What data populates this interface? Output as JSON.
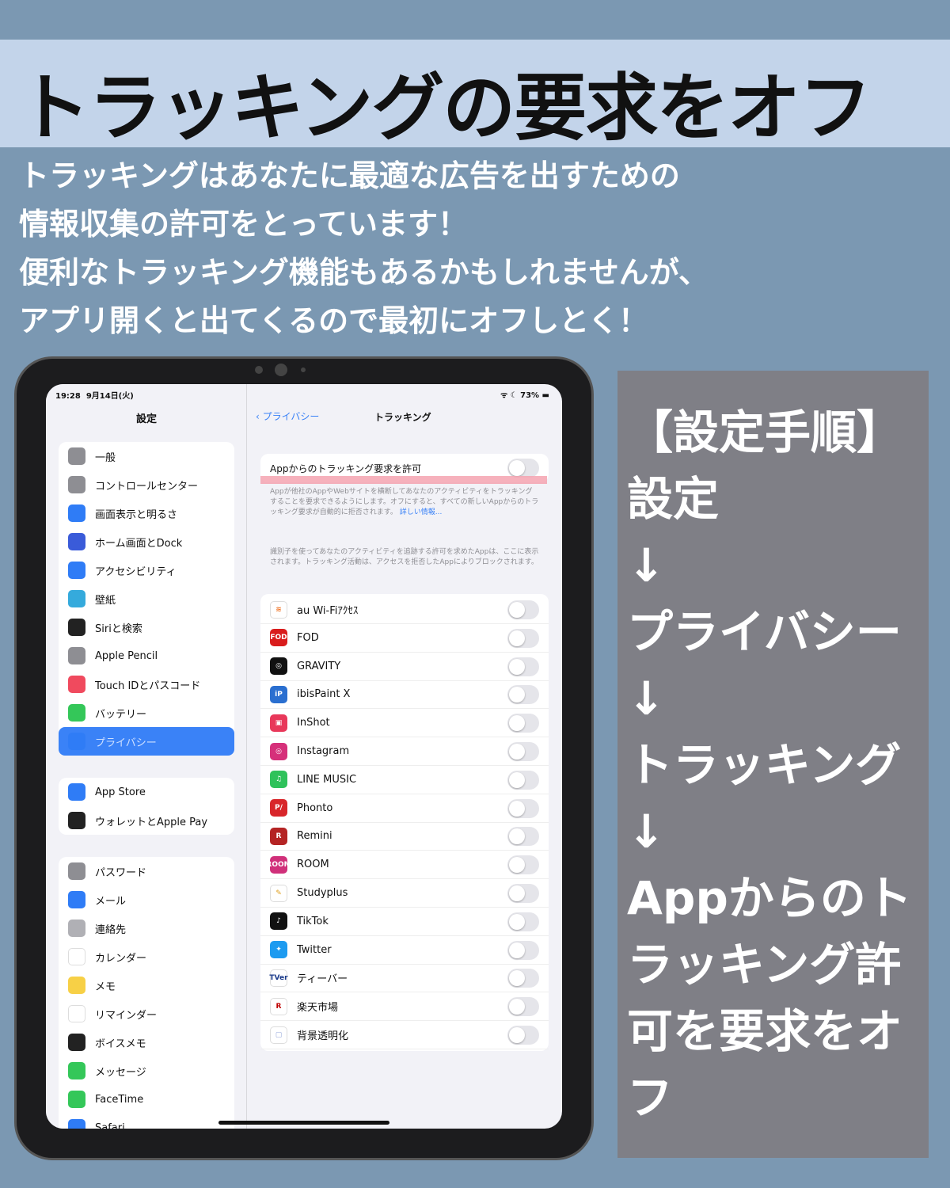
{
  "title": "トラッキングの要求をオフ",
  "intro": [
    "トラッキングはあなたに最適な広告を出すための",
    "情報収集の許可をとっています！",
    "便利なトラッキング機能もあるかもしれませんが、",
    "アプリ開くと出てくるので最初にオフしとく！"
  ],
  "status": {
    "time": "19:28",
    "date": "9月14日(火)",
    "battery": "73%"
  },
  "sidebar": {
    "title": "設定",
    "groups": [
      [
        {
          "label": "一般",
          "color": "#8e8e93",
          "icon": "gear-icon"
        },
        {
          "label": "コントロールセンター",
          "color": "#8e8e93",
          "icon": "toggles-icon"
        },
        {
          "label": "画面表示と明るさ",
          "color": "#2f7cf6",
          "icon": "text-size-icon"
        },
        {
          "label": "ホーム画面とDock",
          "color": "#3a5bd9",
          "icon": "grid-icon"
        },
        {
          "label": "アクセシビリティ",
          "color": "#2f7cf6",
          "icon": "accessibility-icon"
        },
        {
          "label": "壁紙",
          "color": "#35aadc",
          "icon": "flower-icon"
        },
        {
          "label": "Siriと検索",
          "color": "#222",
          "icon": "siri-icon"
        },
        {
          "label": "Apple Pencil",
          "color": "#8e8e93",
          "icon": "pencil-icon"
        },
        {
          "label": "Touch IDとパスコード",
          "color": "#f04a5e",
          "icon": "fingerprint-icon"
        },
        {
          "label": "バッテリー",
          "color": "#34c759",
          "icon": "battery-icon"
        },
        {
          "label": "プライバシー",
          "color": "#2f7cf6",
          "icon": "hand-icon",
          "selected": true
        }
      ],
      [
        {
          "label": "App Store",
          "color": "#2f7cf6",
          "icon": "app-store-icon"
        },
        {
          "label": "ウォレットとApple Pay",
          "color": "#222",
          "icon": "wallet-icon"
        }
      ],
      [
        {
          "label": "パスワード",
          "color": "#8e8e93",
          "icon": "key-icon"
        },
        {
          "label": "メール",
          "color": "#2f7cf6",
          "icon": "mail-icon"
        },
        {
          "label": "連絡先",
          "color": "#b0b0b5",
          "icon": "contacts-icon"
        },
        {
          "label": "カレンダー",
          "color": "#ffffff",
          "icon": "calendar-icon"
        },
        {
          "label": "メモ",
          "color": "#f7d046",
          "icon": "notes-icon"
        },
        {
          "label": "リマインダー",
          "color": "#ffffff",
          "icon": "reminders-icon"
        },
        {
          "label": "ボイスメモ",
          "color": "#222",
          "icon": "voice-memo-icon"
        },
        {
          "label": "メッセージ",
          "color": "#34c759",
          "icon": "message-icon"
        },
        {
          "label": "FaceTime",
          "color": "#34c759",
          "icon": "video-icon"
        },
        {
          "label": "Safari",
          "color": "#2f7cf6",
          "icon": "compass-icon"
        }
      ]
    ]
  },
  "main": {
    "back": "プライバシー",
    "title": "トラッキング",
    "allow_label": "Appからのトラッキング要求を許可",
    "allow_on": false,
    "desc": "Appが他社のAppやWebサイトを横断してあなたのアクティビティをトラッキングすることを要求できるようにします。オフにすると、すべての新しいAppからのトラッキング要求が自動的に拒否されます。",
    "more": "詳しい情報...",
    "note": "識別子を使ってあなたのアクティビティを追跡する許可を求めたAppは、ここに表示されます。トラッキング活動は、アクセスを拒否したAppによりブロックされます。",
    "apps": [
      {
        "name": "au Wi-Fiｱｸｾｽ",
        "color": "#ffffff",
        "fg": "#f07020",
        "icon": "wifi-icon",
        "glyph": "≋"
      },
      {
        "name": "FOD",
        "color": "#d91c1c",
        "icon": "fod-icon",
        "glyph": "FOD"
      },
      {
        "name": "GRAVITY",
        "color": "#111",
        "icon": "gravity-icon",
        "glyph": "◎"
      },
      {
        "name": "ibisPaint X",
        "color": "#2a6fd0",
        "icon": "ibispaint-icon",
        "glyph": "iP"
      },
      {
        "name": "InShot",
        "color": "#e8385a",
        "icon": "inshot-icon",
        "glyph": "▣"
      },
      {
        "name": "Instagram",
        "color": "#d6307a",
        "icon": "instagram-icon",
        "glyph": "◎"
      },
      {
        "name": "LINE MUSIC",
        "color": "#2fc25b",
        "icon": "line-music-icon",
        "glyph": "♫"
      },
      {
        "name": "Phonto",
        "color": "#d8262a",
        "icon": "phonto-icon",
        "glyph": "P/"
      },
      {
        "name": "Remini",
        "color": "#b42424",
        "icon": "remini-icon",
        "glyph": "R"
      },
      {
        "name": "ROOM",
        "color": "#d0307a",
        "icon": "room-icon",
        "glyph": "ROOM"
      },
      {
        "name": "Studyplus",
        "color": "#ffffff",
        "fg": "#e0a020",
        "icon": "studyplus-icon",
        "glyph": "✎"
      },
      {
        "name": "TikTok",
        "color": "#111",
        "icon": "tiktok-icon",
        "glyph": "♪"
      },
      {
        "name": "Twitter",
        "color": "#1d9bf0",
        "icon": "twitter-icon",
        "glyph": "✦"
      },
      {
        "name": "ティーバー",
        "color": "#ffffff",
        "fg": "#1a3a8a",
        "icon": "tver-icon",
        "glyph": "TVer"
      },
      {
        "name": "楽天市場",
        "color": "#ffffff",
        "fg": "#bf0000",
        "icon": "rakuten-icon",
        "glyph": "R"
      },
      {
        "name": "背景透明化",
        "color": "#ffffff",
        "fg": "#9ad",
        "icon": "transparent-bg-icon",
        "glyph": "▢"
      }
    ]
  },
  "steps": {
    "text": "【設定手順】\n設定\n↓\nプライバシー\n↓\nトラッキング\n↓\nAppからのトラッキング許可を要求をオフ"
  },
  "colors": {
    "background": "#7b98b2",
    "band": "#c3d4ea",
    "panel": "#7f7f86",
    "accent": "#3a82f7",
    "highlight": "#f4a3b0"
  }
}
